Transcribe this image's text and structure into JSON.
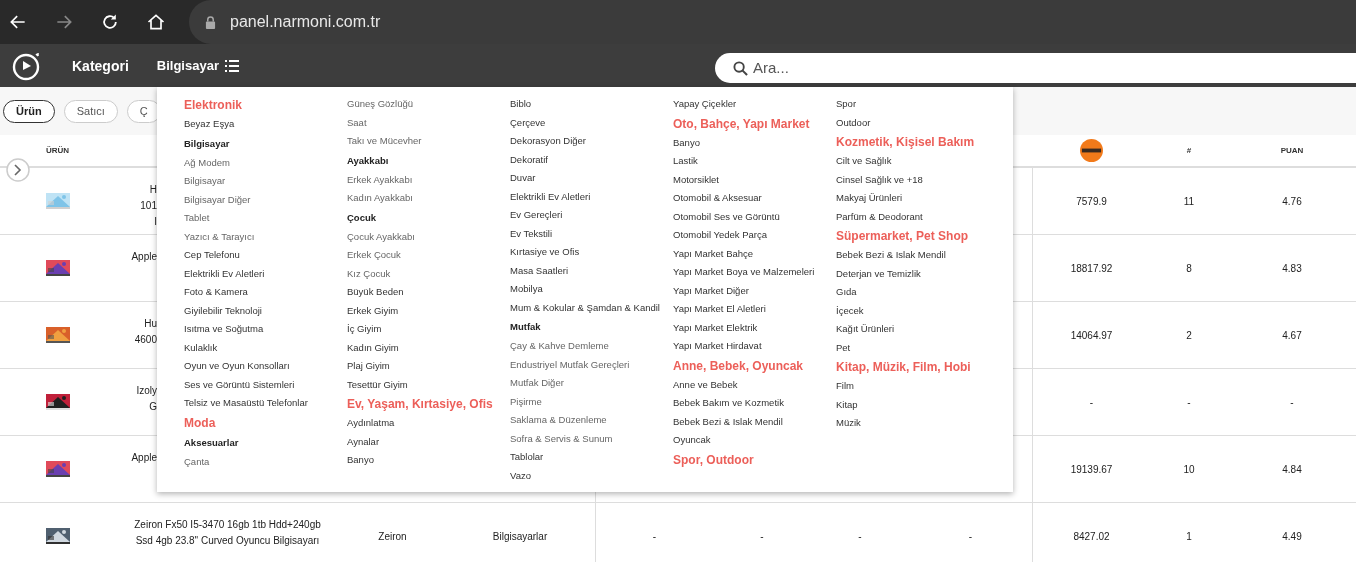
{
  "browser": {
    "url": "panel.narmoni.com.tr"
  },
  "header": {
    "nav": [
      {
        "label": "Kategori",
        "kind": "text"
      },
      {
        "label": "Bilgisayar",
        "kind": "menu"
      }
    ],
    "search": {
      "placeholder": "Ara..."
    }
  },
  "filters": [
    {
      "label": "Ürün",
      "selected": true
    },
    {
      "label": "Satıcı",
      "selected": false
    },
    {
      "label": "Ç",
      "selected": false
    }
  ],
  "table": {
    "columns": [
      {
        "kind": "text",
        "label": "ÜRÜN"
      },
      {
        "kind": "empty"
      },
      {
        "kind": "empty"
      },
      {
        "kind": "empty"
      },
      {
        "kind": "empty"
      },
      {
        "kind": "empty"
      },
      {
        "kind": "empty"
      },
      {
        "kind": "empty"
      },
      {
        "kind": "logo"
      },
      {
        "kind": "text",
        "label": "#"
      },
      {
        "kind": "text",
        "label": "PUAN"
      }
    ],
    "rows": [
      {
        "covered": true,
        "cells": [
          "",
          "H\n101\nI",
          "",
          "",
          "",
          "",
          "",
          "",
          "7579.9",
          "11",
          "4.76"
        ]
      },
      {
        "covered": true,
        "cells": [
          "",
          "Apple",
          "",
          "",
          "",
          "",
          "",
          "",
          "18817.92",
          "8",
          "4.83"
        ]
      },
      {
        "covered": true,
        "cells": [
          "",
          "Hu\n4600",
          "",
          "",
          "",
          "",
          "",
          "",
          "14064.97",
          "2",
          "4.67"
        ]
      },
      {
        "covered": true,
        "cells": [
          "",
          "Izoly\nG",
          "",
          "",
          "",
          "",
          "",
          "",
          "-",
          "-",
          "-"
        ]
      },
      {
        "covered": true,
        "cells": [
          "",
          "Apple",
          "",
          "",
          "",
          "",
          "",
          "",
          "19139.67",
          "10",
          "4.84"
        ]
      },
      {
        "covered": false,
        "cells": [
          "",
          "Zeiron Fx50 I5-3470 16gb 1tb Hdd+240gb\nSsd 4gb 23.8\" Curved Oyuncu Bilgisayarı",
          "Zeiron",
          "Bilgisayarlar",
          "-",
          "-",
          "-",
          "-",
          "8427.02",
          "1",
          "4.49"
        ]
      }
    ]
  },
  "menu": {
    "columns": [
      [
        {
          "kind": "heading",
          "label": "Elektronik"
        },
        {
          "kind": "item",
          "label": "Beyaz Eşya"
        },
        {
          "kind": "group",
          "label": "Bilgisayar"
        },
        {
          "kind": "sub",
          "label": "Ağ Modem"
        },
        {
          "kind": "sub",
          "label": "Bilgisayar"
        },
        {
          "kind": "sub",
          "label": "Bilgisayar Diğer"
        },
        {
          "kind": "sub",
          "label": "Tablet"
        },
        {
          "kind": "sub",
          "label": "Yazıcı & Tarayıcı"
        },
        {
          "kind": "item",
          "label": "Cep Telefonu"
        },
        {
          "kind": "item",
          "label": "Elektrikli Ev Aletleri"
        },
        {
          "kind": "item",
          "label": "Foto & Kamera"
        },
        {
          "kind": "item",
          "label": "Giyilebilir Teknoloji"
        },
        {
          "kind": "item",
          "label": "Isıtma ve Soğutma"
        },
        {
          "kind": "item",
          "label": "Kulaklık"
        },
        {
          "kind": "item",
          "label": "Oyun ve Oyun Konsolları"
        },
        {
          "kind": "item",
          "label": "Ses ve Görüntü Sistemleri"
        },
        {
          "kind": "item",
          "label": "Telsiz ve Masaüstü Telefonlar"
        },
        {
          "kind": "heading",
          "label": "Moda"
        },
        {
          "kind": "group",
          "label": "Aksesuarlar"
        },
        {
          "kind": "sub",
          "label": "Çanta"
        }
      ],
      [
        {
          "kind": "sub",
          "label": "Güneş Gözlüğü"
        },
        {
          "kind": "sub",
          "label": "Saat"
        },
        {
          "kind": "sub",
          "label": "Takı ve Mücevher"
        },
        {
          "kind": "group",
          "label": "Ayakkabı"
        },
        {
          "kind": "sub",
          "label": "Erkek Ayakkabı"
        },
        {
          "kind": "sub",
          "label": "Kadın Ayakkabı"
        },
        {
          "kind": "group",
          "label": "Çocuk"
        },
        {
          "kind": "sub",
          "label": "Çocuk Ayakkabı"
        },
        {
          "kind": "sub",
          "label": "Erkek Çocuk"
        },
        {
          "kind": "sub",
          "label": "Kız Çocuk"
        },
        {
          "kind": "item",
          "label": "Büyük Beden"
        },
        {
          "kind": "item",
          "label": "Erkek Giyim"
        },
        {
          "kind": "item",
          "label": "İç Giyim"
        },
        {
          "kind": "item",
          "label": "Kadın Giyim"
        },
        {
          "kind": "item",
          "label": "Plaj Giyim"
        },
        {
          "kind": "item",
          "label": "Tesettür Giyim"
        },
        {
          "kind": "heading",
          "label": "Ev, Yaşam, Kırtasiye, Ofis"
        },
        {
          "kind": "item",
          "label": "Aydınlatma"
        },
        {
          "kind": "item",
          "label": "Aynalar"
        },
        {
          "kind": "item",
          "label": "Banyo"
        }
      ],
      [
        {
          "kind": "item",
          "label": "Biblo"
        },
        {
          "kind": "item",
          "label": "Çerçeve"
        },
        {
          "kind": "item",
          "label": "Dekorasyon Diğer"
        },
        {
          "kind": "item",
          "label": "Dekoratif"
        },
        {
          "kind": "item",
          "label": "Duvar"
        },
        {
          "kind": "item",
          "label": "Elektrikli Ev Aletleri"
        },
        {
          "kind": "item",
          "label": "Ev Gereçleri"
        },
        {
          "kind": "item",
          "label": "Ev Tekstili"
        },
        {
          "kind": "item",
          "label": "Kırtasiye ve Ofis"
        },
        {
          "kind": "item",
          "label": "Masa Saatleri"
        },
        {
          "kind": "item",
          "label": "Mobilya"
        },
        {
          "kind": "item",
          "label": "Mum & Kokular & Şamdan & Kandil"
        },
        {
          "kind": "group",
          "label": "Mutfak"
        },
        {
          "kind": "sub",
          "label": "Çay & Kahve Demleme"
        },
        {
          "kind": "sub",
          "label": "Endustriyel Mutfak Gereçleri"
        },
        {
          "kind": "sub",
          "label": "Mutfak Diğer"
        },
        {
          "kind": "sub",
          "label": "Pişirme"
        },
        {
          "kind": "sub",
          "label": "Saklama & Düzenleme"
        },
        {
          "kind": "sub",
          "label": "Sofra & Servis & Sunum"
        },
        {
          "kind": "item",
          "label": "Tablolar"
        },
        {
          "kind": "item",
          "label": "Vazo"
        }
      ],
      [
        {
          "kind": "item",
          "label": "Yapay Çiçekler"
        },
        {
          "kind": "heading",
          "label": "Oto, Bahçe, Yapı Market"
        },
        {
          "kind": "item",
          "label": "Banyo"
        },
        {
          "kind": "item",
          "label": "Lastik"
        },
        {
          "kind": "item",
          "label": "Motorsiklet"
        },
        {
          "kind": "item",
          "label": "Otomobil & Aksesuar"
        },
        {
          "kind": "item",
          "label": "Otomobil Ses ve Görüntü"
        },
        {
          "kind": "item",
          "label": "Otomobil Yedek Parça"
        },
        {
          "kind": "item",
          "label": "Yapı Market Bahçe"
        },
        {
          "kind": "item",
          "label": "Yapı Market Boya ve Malzemeleri"
        },
        {
          "kind": "item",
          "label": "Yapı Market Diğer"
        },
        {
          "kind": "item",
          "label": "Yapı Market El Aletleri"
        },
        {
          "kind": "item",
          "label": "Yapı Market Elektrik"
        },
        {
          "kind": "item",
          "label": "Yapı Market Hirdavat"
        },
        {
          "kind": "heading",
          "label": "Anne, Bebek, Oyuncak"
        },
        {
          "kind": "item",
          "label": "Anne ve Bebek"
        },
        {
          "kind": "item",
          "label": "Bebek Bakım ve Kozmetik"
        },
        {
          "kind": "item",
          "label": "Bebek Bezi & Islak Mendil"
        },
        {
          "kind": "item",
          "label": "Oyuncak"
        },
        {
          "kind": "heading",
          "label": "Spor, Outdoor"
        }
      ],
      [
        {
          "kind": "item",
          "label": "Spor"
        },
        {
          "kind": "item",
          "label": "Outdoor"
        },
        {
          "kind": "heading",
          "label": "Kozmetik, Kişisel Bakım"
        },
        {
          "kind": "item",
          "label": "Cilt ve Sağlık"
        },
        {
          "kind": "item",
          "label": "Cinsel Sağlık ve +18"
        },
        {
          "kind": "item",
          "label": "Makyaj Ürünleri"
        },
        {
          "kind": "item",
          "label": "Parfüm & Deodorant"
        },
        {
          "kind": "heading",
          "label": "Süpermarket, Pet Shop"
        },
        {
          "kind": "item",
          "label": "Bebek Bezi & Islak Mendil"
        },
        {
          "kind": "item",
          "label": "Deterjan ve Temizlik"
        },
        {
          "kind": "item",
          "label": "Gıda"
        },
        {
          "kind": "item",
          "label": "İçecek"
        },
        {
          "kind": "item",
          "label": "Kağıt Ürünleri"
        },
        {
          "kind": "item",
          "label": "Pet"
        },
        {
          "kind": "heading",
          "label": "Kitap, Müzik, Film, Hobi"
        },
        {
          "kind": "item",
          "label": "Film"
        },
        {
          "kind": "item",
          "label": "Kitap"
        },
        {
          "kind": "item",
          "label": "Müzik"
        }
      ]
    ]
  }
}
